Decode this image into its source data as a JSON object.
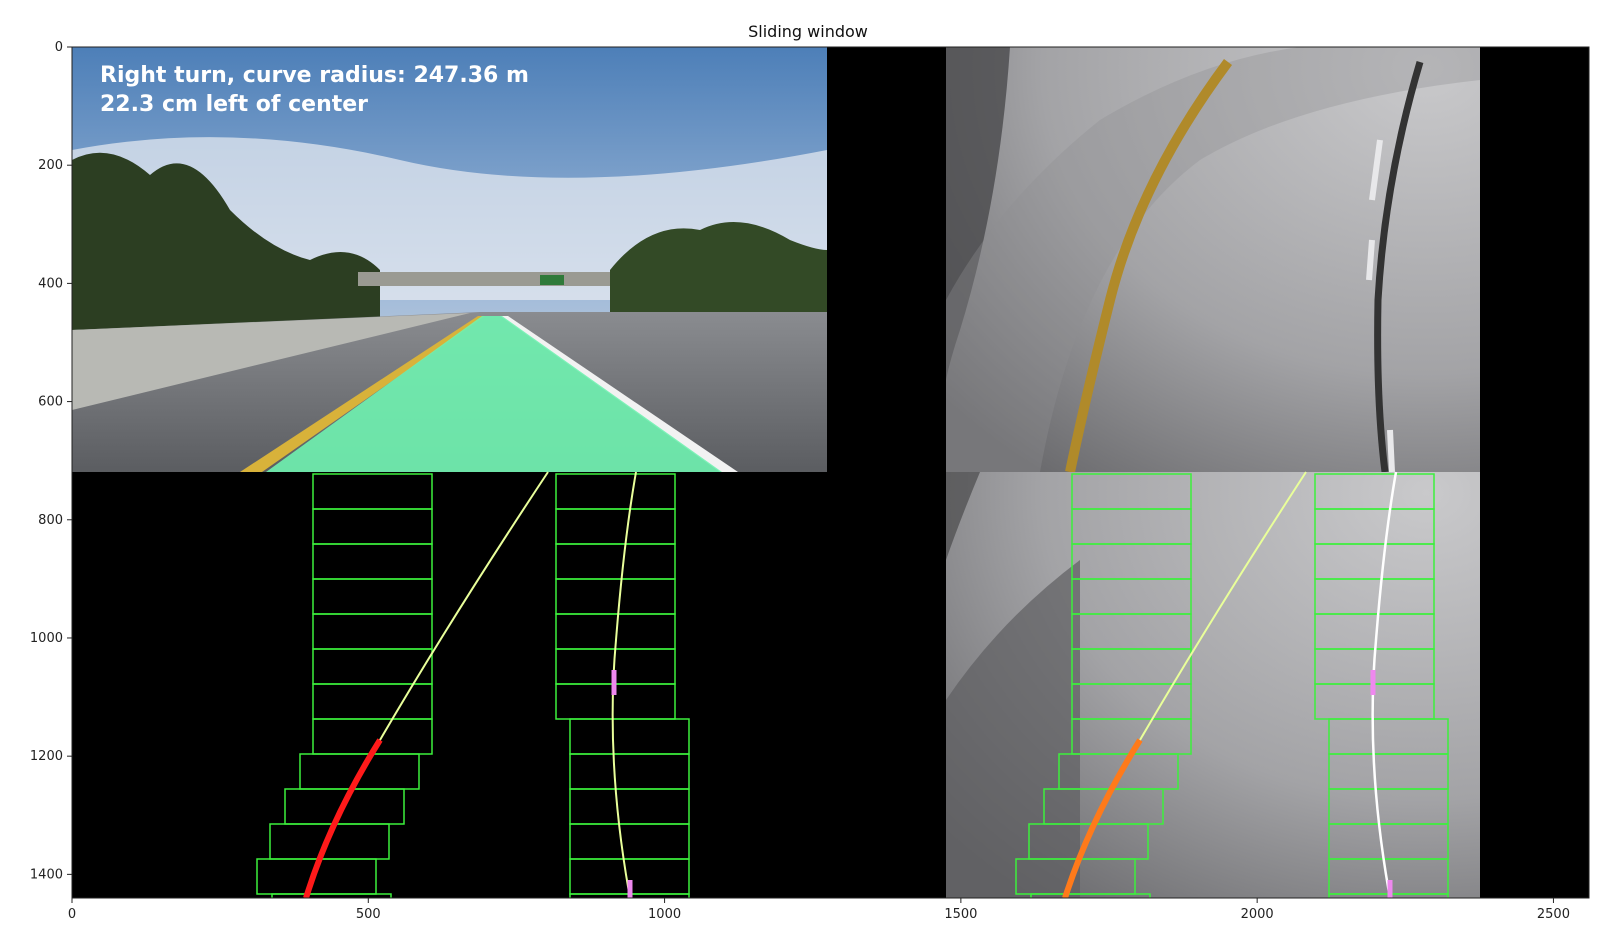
{
  "figure": {
    "title": "Sliding window"
  },
  "overlay": {
    "line1": "Right turn, curve radius: 247.36 m",
    "line2": "22.3 cm left of center"
  },
  "axes": {
    "x_ticks": [
      {
        "value": 0,
        "label": "0"
      },
      {
        "value": 500,
        "label": "500"
      },
      {
        "value": 1000,
        "label": "1000"
      },
      {
        "value": 1500,
        "label": "1500"
      },
      {
        "value": 2000,
        "label": "2000"
      },
      {
        "value": 2500,
        "label": "2500"
      }
    ],
    "y_ticks": [
      {
        "value": 0,
        "label": "0"
      },
      {
        "value": 200,
        "label": "200"
      },
      {
        "value": 400,
        "label": "400"
      },
      {
        "value": 600,
        "label": "600"
      },
      {
        "value": 800,
        "label": "800"
      },
      {
        "value": 1000,
        "label": "1000"
      },
      {
        "value": 1200,
        "label": "1200"
      },
      {
        "value": 1400,
        "label": "1400"
      }
    ]
  },
  "colors": {
    "window_box": "#3cf03c",
    "fit_line": "#e9ff9a",
    "left_pixels": "#ff1a1a",
    "right_pixels": "#ee88ee",
    "lane_fill": "#6ff2b0",
    "black": "#000000"
  }
}
